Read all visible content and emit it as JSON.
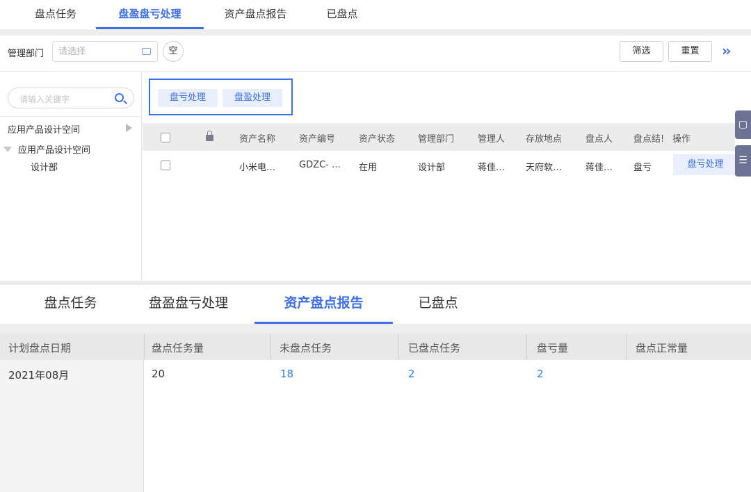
{
  "top_tabs": [
    "盘点任务",
    "盘盈盘亏处理",
    "资产盘点报告",
    "已盘点"
  ],
  "toolbar": {
    "dept_label": "管理部门",
    "dept_placeholder": "请选择",
    "clear_label": "空",
    "filter_label": "筛选",
    "reset_label": "重置",
    "expand_icon": "double-chevron-right-icon"
  },
  "sidebar": {
    "search_placeholder": "请输入关键字",
    "tree": [
      {
        "label": "应用产品设计空间",
        "state": "collapsed"
      },
      {
        "label": "应用产品设计空间",
        "state": "expanded"
      },
      {
        "label": "设计部",
        "state": "leaf"
      }
    ]
  },
  "actions": {
    "loss_label": "盘亏处理",
    "gain_label": "盘盈处理"
  },
  "asset_table": {
    "headers": [
      "资产名称",
      "资产编号",
      "资产状态",
      "管理部门",
      "管理人",
      "存放地点",
      "盘点人",
      "盘点结!",
      "操作"
    ],
    "rows": [
      {
        "name": "小米电…",
        "code": "GDZC- …",
        "status": "在用",
        "dept": "设计部",
        "manager": "蒋佳…",
        "location": "天府软…",
        "checker": "蒋佳…",
        "result": "盘亏",
        "op": "盘亏处理"
      }
    ]
  },
  "bottom_tabs": [
    "盘点任务",
    "盘盈盘亏处理",
    "资产盘点报告",
    "已盘点"
  ],
  "report": {
    "headers": [
      "计划盘点日期",
      "盘点任务量",
      "未盘点任务",
      "已盘点任务",
      "盘亏量",
      "盘点正常量"
    ],
    "row": {
      "date": "2021年08月",
      "total": "20",
      "pending": "18",
      "done": "2",
      "loss": "2",
      "normal": ""
    }
  },
  "colors": {
    "accent": "#3d6fe6",
    "link": "#2f7ed8",
    "action_bg": "#e8eefb",
    "float_btn": "#6c7294"
  }
}
